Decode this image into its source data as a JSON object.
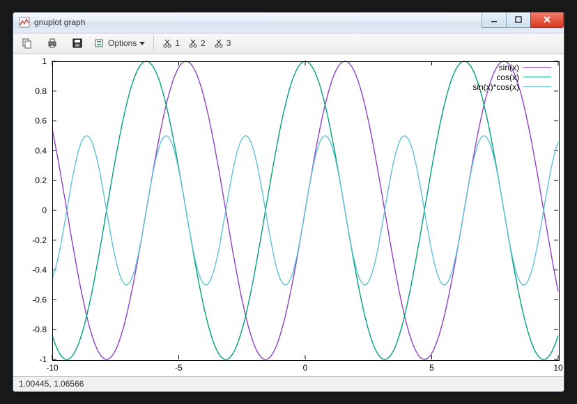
{
  "window": {
    "title": "gnuplot graph"
  },
  "toolbar": {
    "options_label": "Options",
    "x1": "1",
    "x2": "2",
    "x3": "3"
  },
  "status": {
    "coords": "1.00445, 1.06566"
  },
  "chart_data": {
    "type": "line",
    "xlim": [
      -10,
      10
    ],
    "ylim": [
      -1,
      1
    ],
    "xticks": [
      -10,
      -5,
      0,
      5,
      10
    ],
    "yticks": [
      -1,
      -0.8,
      -0.6,
      -0.4,
      -0.2,
      0,
      0.2,
      0.4,
      0.6,
      0.8,
      1
    ],
    "legend_position": "top-right",
    "series": [
      {
        "name": "sin(x)",
        "fn": "sin",
        "color": "#9040c0"
      },
      {
        "name": "cos(x)",
        "fn": "cos",
        "color": "#00a080"
      },
      {
        "name": "sin(x)*cos(x)",
        "fn": "sincos",
        "color": "#60c0d8"
      }
    ]
  }
}
